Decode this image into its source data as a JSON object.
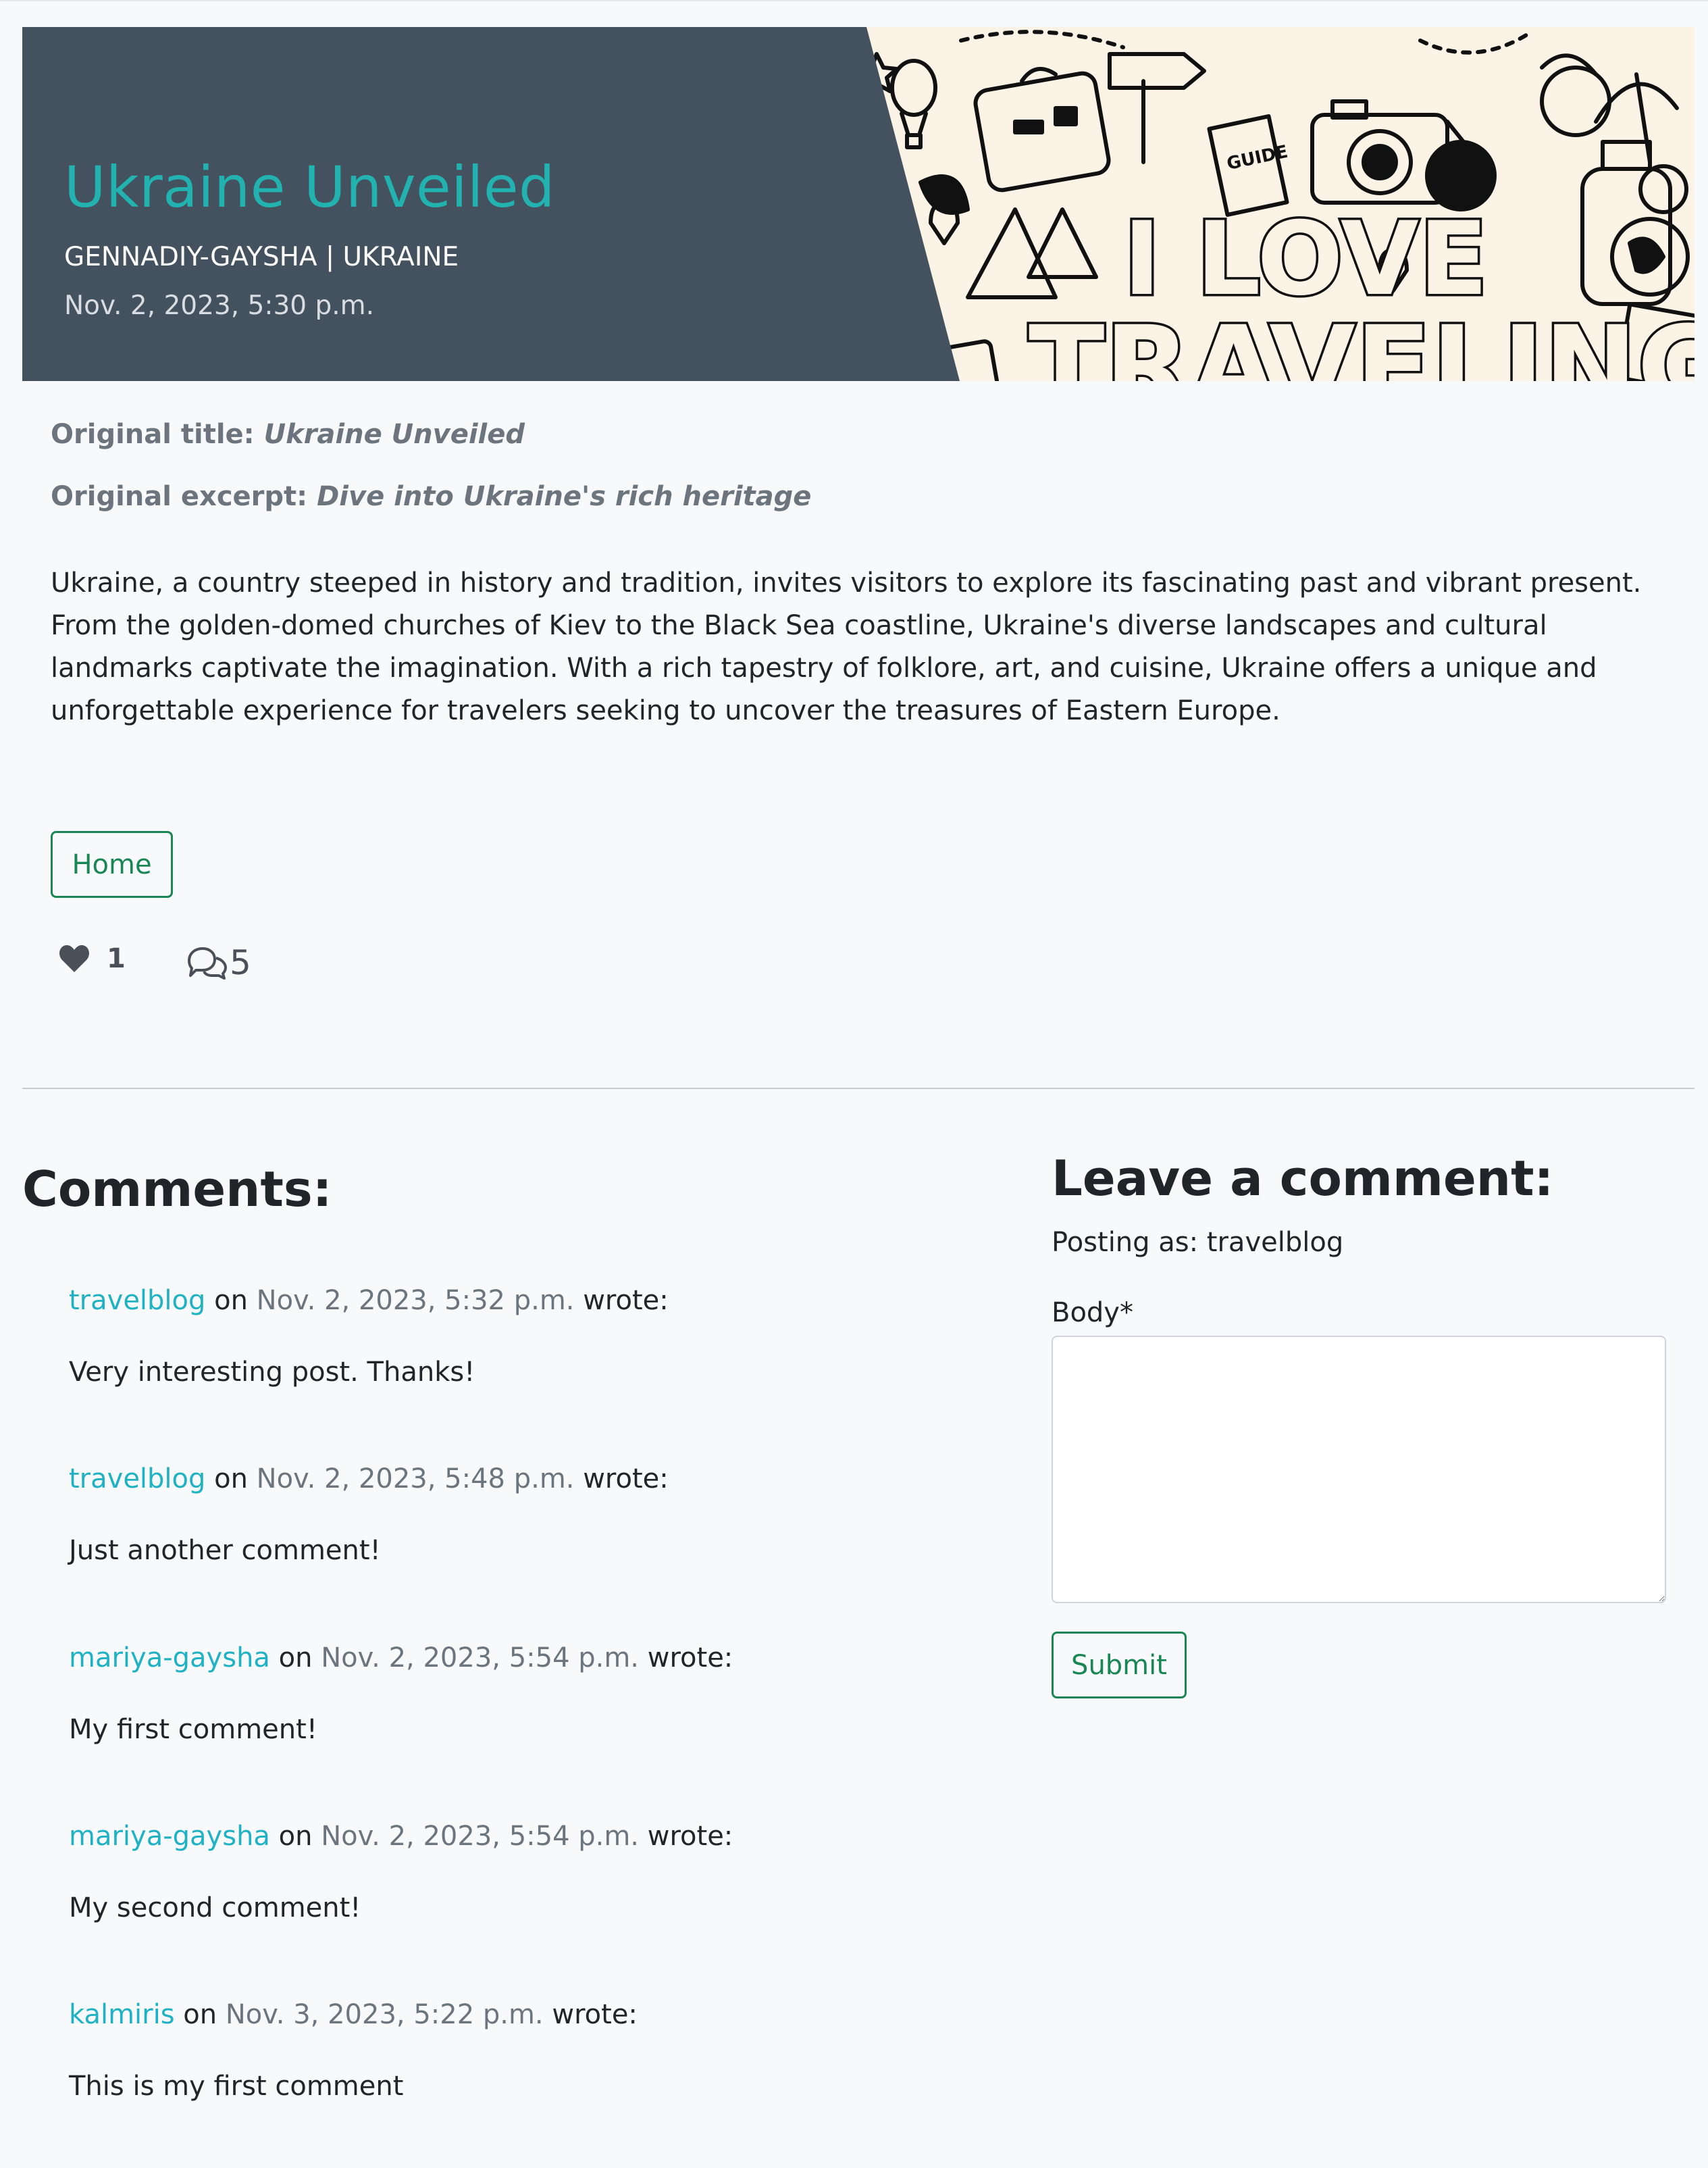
{
  "post": {
    "title": "Ukraine Unveiled",
    "meta": "GENNADIY-GAYSHA | UKRAINE",
    "date": "Nov. 2, 2023, 5:30 p.m.",
    "banner_text_line1": "I LOVE",
    "banner_text_line2": "TRAVELING",
    "banner_guide_label": "GUIDE",
    "original_title_label": "Original title:",
    "original_title": "Ukraine Unveiled",
    "original_excerpt_label": "Original excerpt:",
    "original_excerpt": "Dive into Ukraine's rich heritage",
    "content": "Ukraine, a country steeped in history and tradition, invites visitors to explore its fascinating past and vibrant present. From the golden-domed churches of Kiev to the Black Sea coastline, Ukraine's diverse landscapes and cultural landmarks captivate the imagination. With a rich tapestry of folklore, art, and cuisine, Ukraine offers a unique and unforgettable experience for travelers seeking to uncover the treasures of Eastern Europe.",
    "home_button": "Home",
    "like_count": "1",
    "comment_count": "5"
  },
  "icons": {
    "like": "heart-icon",
    "comments": "chat-bubbles-icon"
  },
  "comments": {
    "heading": "Comments:",
    "on_word": "on",
    "wrote_word": "wrote:",
    "items": [
      {
        "author": "travelblog",
        "date": "Nov. 2, 2023, 5:32 p.m.",
        "body": "Very interesting post. Thanks!"
      },
      {
        "author": "travelblog",
        "date": "Nov. 2, 2023, 5:48 p.m.",
        "body": "Just another comment!"
      },
      {
        "author": "mariya-gaysha",
        "date": "Nov. 2, 2023, 5:54 p.m.",
        "body": "My first comment!"
      },
      {
        "author": "mariya-gaysha",
        "date": "Nov. 2, 2023, 5:54 p.m.",
        "body": "My second comment!"
      },
      {
        "author": "kalmiris",
        "date": "Nov. 3, 2023, 5:22 p.m.",
        "body": "This is my first comment"
      }
    ]
  },
  "comment_form": {
    "heading": "Leave a comment:",
    "posting_as": "Posting as: travelblog",
    "body_label": "Body*",
    "body_value": "",
    "submit_label": "Submit"
  },
  "colors": {
    "header_bg": "#44515f",
    "title": "#22b2b0",
    "accent_green": "#198754",
    "author_link": "#1fb1c4",
    "banner_bg": "#fbf3e5"
  }
}
